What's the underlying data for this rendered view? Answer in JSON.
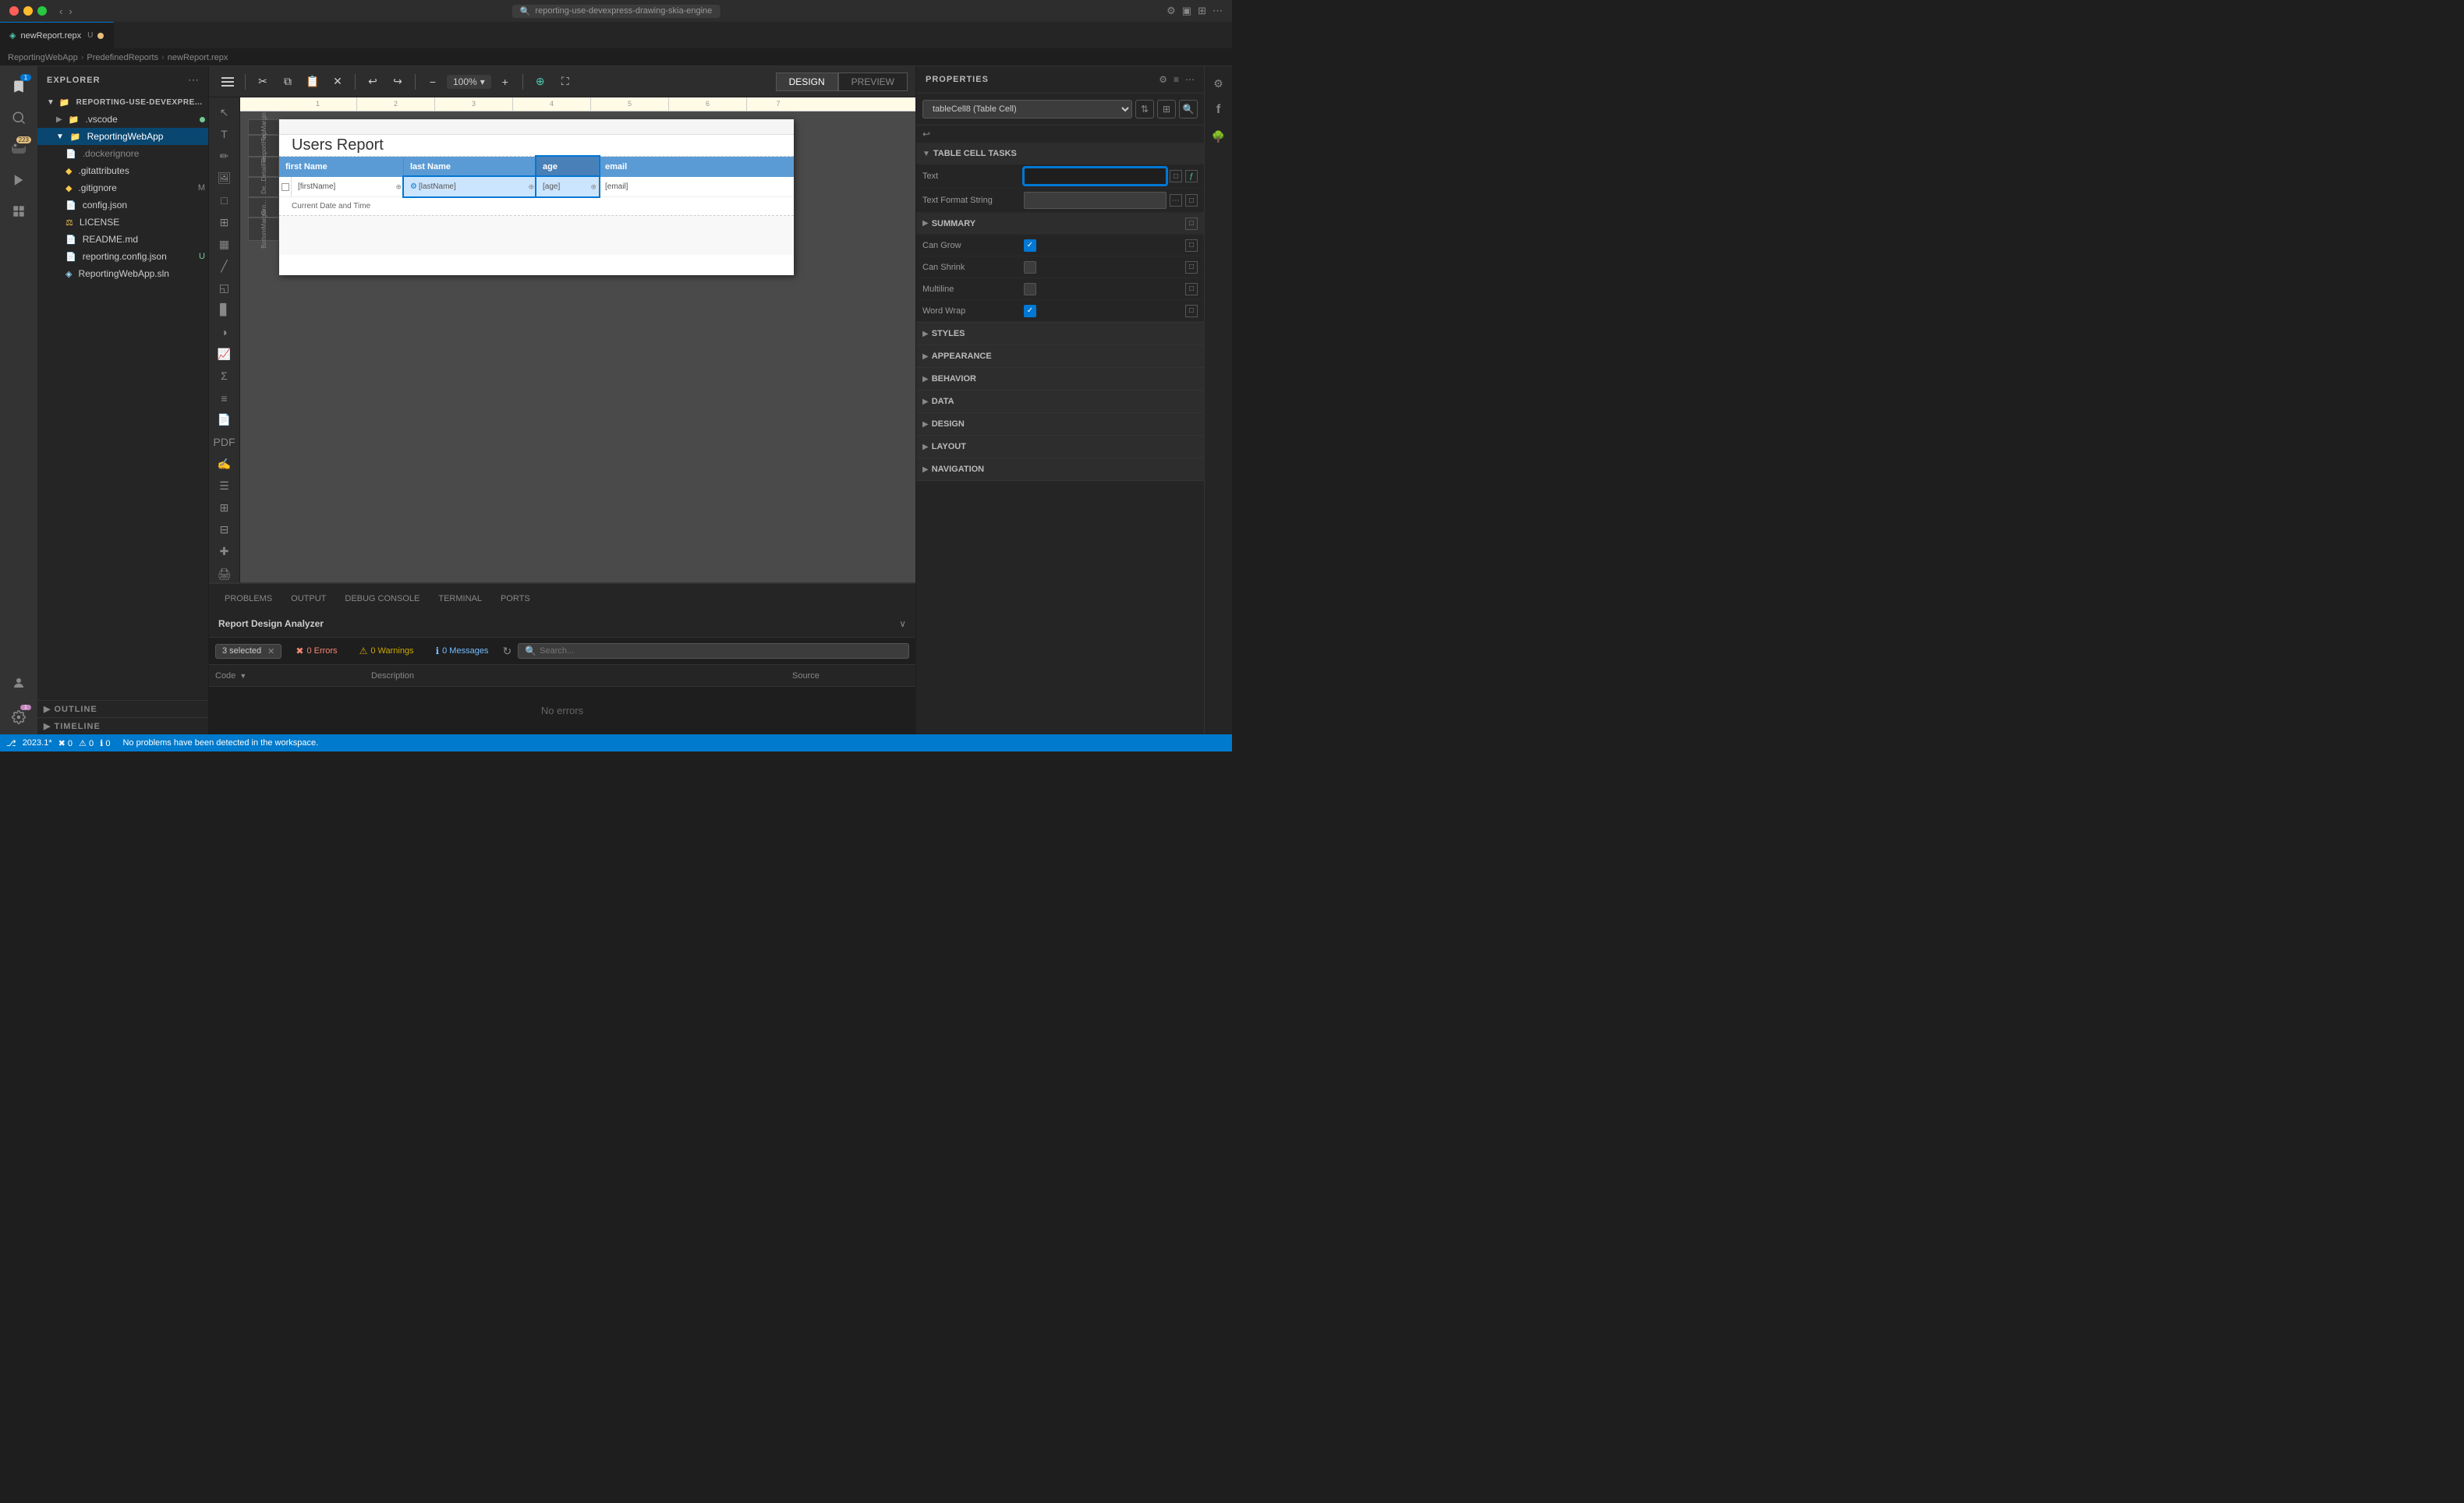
{
  "titlebar": {
    "title": "reporting-use-devexpress-drawing-skia-engine"
  },
  "tabs": [
    {
      "label": "newReport.repx",
      "modified": true,
      "active": true
    }
  ],
  "breadcrumb": [
    "ReportingWebApp",
    "PredefinedReports",
    "newReport.repx"
  ],
  "toolbar": {
    "zoom": "100%",
    "design_label": "DESIGN",
    "preview_label": "PREVIEW"
  },
  "explorer": {
    "title": "EXPLORER",
    "root": "REPORTING-USE-DEVEXPRE...",
    "items": [
      {
        "label": ".vscode",
        "type": "folder",
        "dot": "green"
      },
      {
        "label": "ReportingWebApp",
        "type": "folder",
        "active": true
      },
      {
        "label": ".dockerignore",
        "type": "file"
      },
      {
        "label": ".gitattributes",
        "type": "file"
      },
      {
        "label": ".gitignore",
        "type": "file",
        "tag": "M"
      },
      {
        "label": "config.json",
        "type": "file"
      },
      {
        "label": "LICENSE",
        "type": "file"
      },
      {
        "label": "README.md",
        "type": "file"
      },
      {
        "label": "reporting.config.json",
        "type": "file",
        "tag": "U"
      },
      {
        "label": "ReportingWebApp.sln",
        "type": "file"
      }
    ]
  },
  "report": {
    "title": "Users Report",
    "sections": [
      "TopMargin",
      "ReportHeader",
      "DetailRe...",
      "De...",
      "Gro...",
      "BottomMargin"
    ],
    "table": {
      "headers": [
        "first Name",
        "last Name",
        "age",
        "email"
      ],
      "row": [
        "[firstName]",
        "[lastName]",
        "[age]",
        "[email]"
      ],
      "date_label": "Current Date and Time"
    }
  },
  "properties": {
    "title": "PROPERTIES",
    "selector": "tableCell8 (Table Cell)",
    "sections": {
      "table_cell_tasks": "TABLE CELL TASKS",
      "summary": "SUMMARY",
      "styles": "STYLES",
      "appearance": "APPEARANCE",
      "behavior": "BEHAVIOR",
      "data": "DATA",
      "design": "DESIGN",
      "layout": "LAYOUT",
      "navigation": "NAVIGATION"
    },
    "fields": {
      "text_label": "Text",
      "text_value": "",
      "text_format_string_label": "Text Format String",
      "text_format_string_value": "",
      "can_grow_label": "Can Grow",
      "can_grow_checked": true,
      "can_shrink_label": "Can Shrink",
      "can_shrink_checked": false,
      "multiline_label": "Multiline",
      "multiline_checked": false,
      "word_wrap_label": "Word Wrap",
      "word_wrap_checked": true
    }
  },
  "analyzer": {
    "title": "Report Design Analyzer",
    "filter": "3 selected",
    "errors": "0 Errors",
    "warnings": "0 Warnings",
    "messages": "0 Messages",
    "no_errors": "No errors",
    "columns": {
      "code": "Code",
      "description": "Description",
      "source": "Source"
    },
    "search_placeholder": "Search..."
  },
  "panel_tabs": [
    "PROBLEMS",
    "OUTPUT",
    "DEBUG CONSOLE",
    "TERMINAL",
    "PORTS"
  ],
  "statusbar": {
    "version": "2023.1*",
    "errors": "0",
    "warnings": "0",
    "info": "0",
    "no_problems": "No problems have been detected in the workspace."
  }
}
